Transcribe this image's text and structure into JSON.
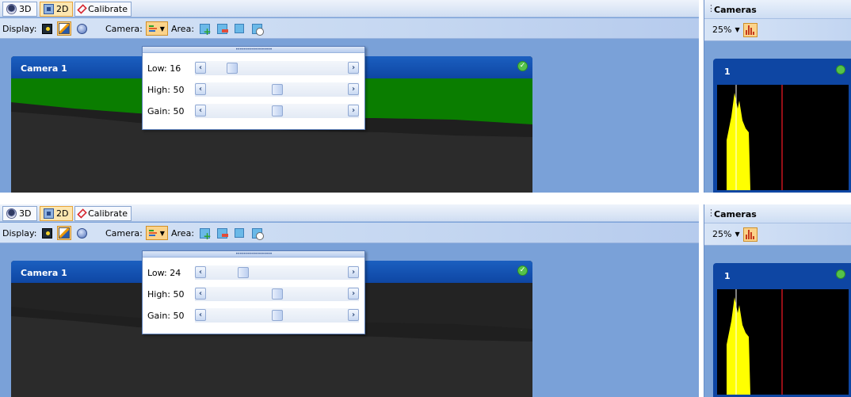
{
  "colors": {
    "accent_blue": "#0e46a3",
    "panel_blue": "#7aa1d8",
    "green_overlay": "#0a7d00",
    "histogram_fill": "#ffff00",
    "threshold_line": "#c8141e",
    "ok_green": "#55c24a"
  },
  "panels": [
    {
      "tabs": [
        {
          "label": "3D",
          "icon": "shield-icon",
          "active": false
        },
        {
          "label": "2D",
          "icon": "grid-2d-icon",
          "active": true
        },
        {
          "label": "Calibrate",
          "icon": "diamond-icon",
          "active": false
        }
      ],
      "toolbar": {
        "display_label": "Display:",
        "camera_label": "Camera:",
        "area_label": "Area:"
      },
      "camera": {
        "title": "Camera 1",
        "status": "ok",
        "green_overlay": true
      },
      "sliders": [
        {
          "label": "Low: 16",
          "value": 16
        },
        {
          "label": "High: 50",
          "value": 50
        },
        {
          "label": "Gain: 50",
          "value": 50
        }
      ],
      "sidebar": {
        "title": "Cameras",
        "zoom": "25%",
        "camera_number": "1"
      }
    },
    {
      "tabs": [
        {
          "label": "3D",
          "icon": "shield-icon",
          "active": false
        },
        {
          "label": "2D",
          "icon": "grid-2d-icon",
          "active": true
        },
        {
          "label": "Calibrate",
          "icon": "diamond-icon",
          "active": false
        }
      ],
      "toolbar": {
        "display_label": "Display:",
        "camera_label": "Camera:",
        "area_label": "Area:"
      },
      "camera": {
        "title": "Camera 1",
        "status": "ok",
        "green_overlay": false
      },
      "sliders": [
        {
          "label": "Low: 24",
          "value": 24
        },
        {
          "label": "High: 50",
          "value": 50
        },
        {
          "label": "Gain: 50",
          "value": 50
        }
      ],
      "sidebar": {
        "title": "Cameras",
        "zoom": "25%",
        "camera_number": "1"
      }
    }
  ]
}
